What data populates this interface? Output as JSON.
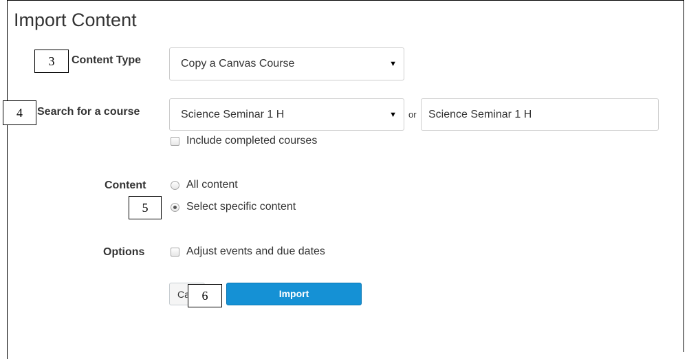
{
  "page": {
    "title": "Import Content"
  },
  "content_type": {
    "label": "Content Type",
    "selected": "Copy a Canvas Course"
  },
  "search": {
    "label": "Search for a course",
    "selected": "Science Seminar 1 H",
    "or_text": "or",
    "input_value": "Science Seminar 1 H",
    "include_completed_label": "Include completed courses",
    "include_completed_checked": false
  },
  "content": {
    "label": "Content",
    "options": [
      {
        "label": "All content",
        "checked": false
      },
      {
        "label": "Select specific content",
        "checked": true
      }
    ]
  },
  "options": {
    "label": "Options",
    "adjust_dates_label": "Adjust events and due dates",
    "adjust_dates_checked": false
  },
  "buttons": {
    "cancel_visible_text": "Ca",
    "import_label": "Import"
  },
  "step_markers": [
    "3",
    "4",
    "5",
    "6"
  ],
  "colors": {
    "primary_button": "#1591d5",
    "text": "#333333",
    "border": "#cccccc"
  }
}
